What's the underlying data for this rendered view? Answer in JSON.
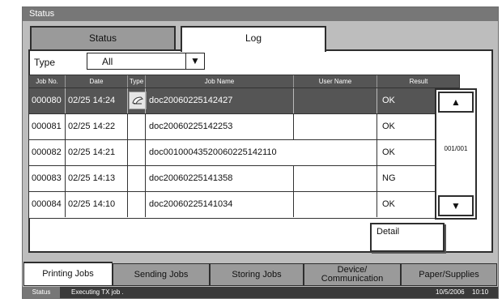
{
  "window_title": "Status",
  "tabs": [
    {
      "label": "Status",
      "active": false
    },
    {
      "label": "Log",
      "active": true
    }
  ],
  "type_filter": {
    "label": "Type",
    "value": "All"
  },
  "table": {
    "headers": [
      "Job No.",
      "Date",
      "Type",
      "Job Name",
      "User Name",
      "Result"
    ],
    "rows": [
      {
        "job_no": "000080",
        "date": "02/25 14:24",
        "type_icon": "document-icon",
        "job_name": "doc20060225142427",
        "user_name": "",
        "result": "OK",
        "selected": true
      },
      {
        "job_no": "000081",
        "date": "02/25 14:22",
        "type_icon": "",
        "job_name": "doc20060225142253",
        "user_name": "",
        "result": "OK",
        "selected": false
      },
      {
        "job_no": "000082",
        "date": "02/25 14:21",
        "type_icon": "",
        "job_name": "doc00100043520060225142110",
        "user_name": "",
        "result": "OK",
        "selected": false
      },
      {
        "job_no": "000083",
        "date": "02/25 14:13",
        "type_icon": "",
        "job_name": "doc20060225141358",
        "user_name": "",
        "result": "NG",
        "selected": false
      },
      {
        "job_no": "000084",
        "date": "02/25 14:10",
        "type_icon": "",
        "job_name": "doc20060225141034",
        "user_name": "",
        "result": "OK",
        "selected": false
      }
    ]
  },
  "pager": {
    "indicator": "001/001",
    "up_icon": "triangle-up-icon",
    "down_icon": "triangle-down-icon"
  },
  "detail_button": "Detail",
  "bottom_tabs": [
    {
      "label": "Printing Jobs",
      "active": true
    },
    {
      "label": "Sending Jobs",
      "active": false
    },
    {
      "label": "Storing Jobs",
      "active": false
    },
    {
      "label": "Device/\nCommunication",
      "active": false
    },
    {
      "label": "Paper/Supplies",
      "active": false
    }
  ],
  "status_bar": {
    "label": "Status",
    "message": "Executing TX job .",
    "date": "10/5/2006",
    "time": "10:10"
  }
}
